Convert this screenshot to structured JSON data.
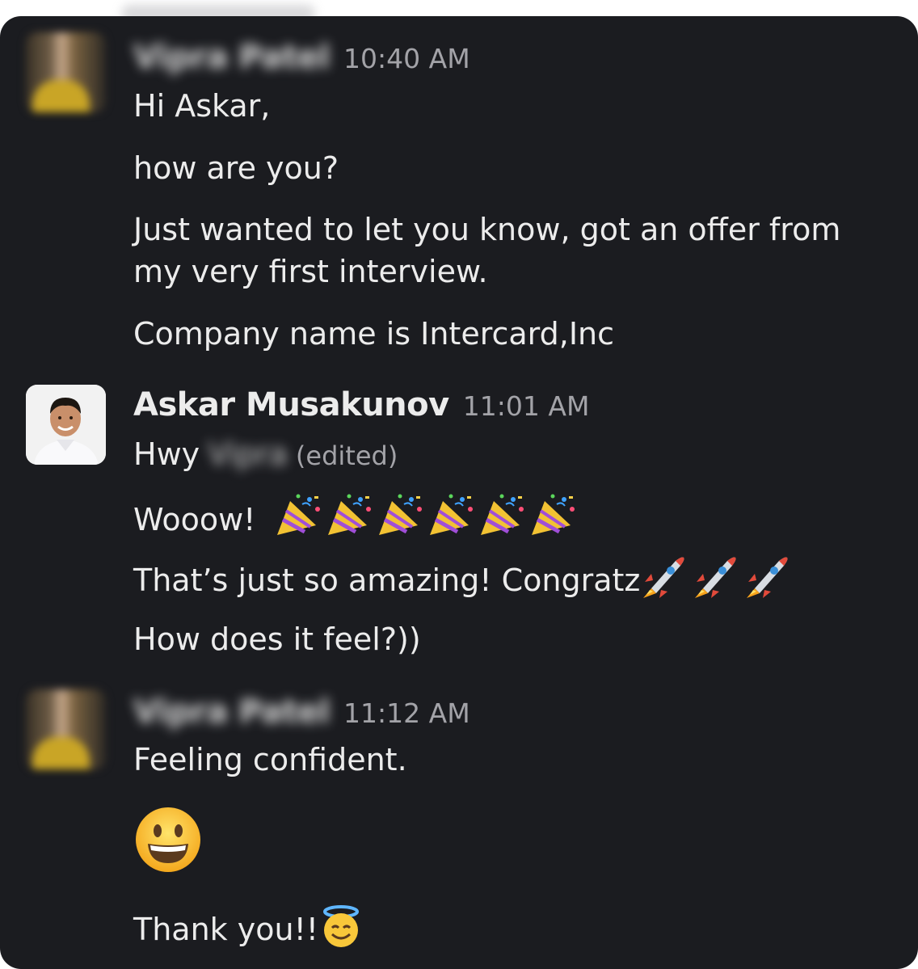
{
  "messages": [
    {
      "sender": "Vipra Patel",
      "time": "10:40 AM",
      "lines": [
        "Hi Askar,",
        "how are you?",
        "Just wanted to let you know, got an offer from my very first interview.",
        "Company name is Intercard,Inc"
      ]
    },
    {
      "sender": "Askar Musakunov",
      "time": "11:01 AM",
      "line1_prefix": "Hwy",
      "line1_blurred": "Vipra",
      "edited": "(edited)",
      "line2": "Wooow!",
      "line3": "That’s just so amazing! Congratz",
      "line4": "How does it feel?))",
      "emoji": [
        "party-popper-icon",
        "rocket-icon"
      ]
    },
    {
      "sender": "Vipra Patel",
      "time": "11:12 AM",
      "line1": "Feeling confident.",
      "line3": "Thank you!!",
      "emoji": [
        "grinning-face-icon",
        "smiling-face-with-halo-icon"
      ]
    }
  ],
  "colors": {
    "background": "#1b1c20",
    "text": "#ececec",
    "muted": "#a3a3a8"
  }
}
